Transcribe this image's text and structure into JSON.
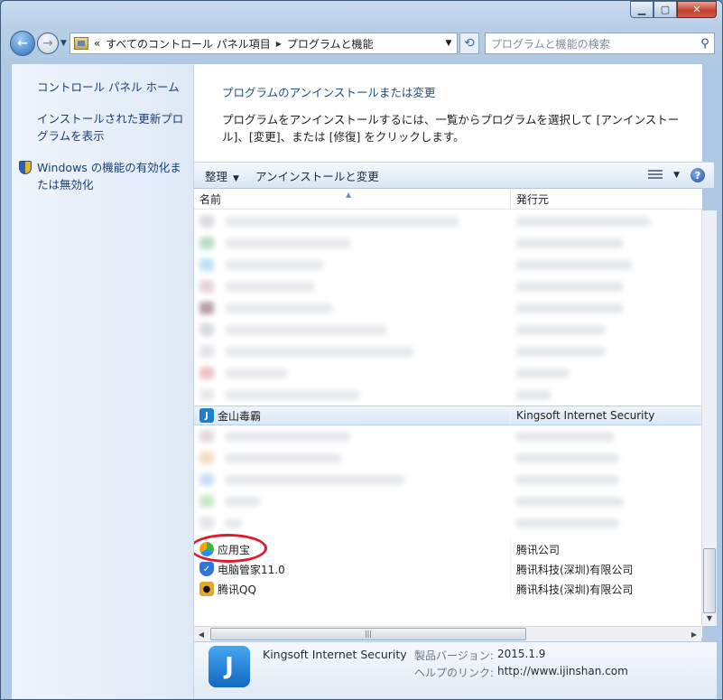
{
  "address": {
    "prefix": "«",
    "crumbs": [
      "すべてのコントロール パネル項目",
      "プログラムと機能"
    ]
  },
  "search": {
    "placeholder": "プログラムと機能の検索"
  },
  "left_pane": {
    "links": [
      "コントロール パネル ホーム",
      "インストールされた更新プログラムを表示",
      "Windows の機能の有効化または無効化"
    ]
  },
  "main": {
    "title": "プログラムのアンインストールまたは変更",
    "description": "プログラムをアンインストールするには、一覧からプログラムを選択して [アンインストール]、[変更]、または [修復] をクリックします。"
  },
  "commandbar": {
    "organize": "整理",
    "uninstall": "アンインストールと変更"
  },
  "columns": {
    "name": "名前",
    "publisher": "発行元"
  },
  "programs": [
    {
      "name": "金山毒霸",
      "publisher": "Kingsoft Internet Security",
      "selected": true,
      "icon": "kingsoft-icon"
    },
    {
      "name": "应用宝",
      "publisher": "腾讯公司",
      "icon": "yingyongbao-icon"
    },
    {
      "name": "电脑管家11.0",
      "publisher": "腾讯科技(深圳)有限公司",
      "icon": "pc-manager-icon"
    },
    {
      "name": "腾讯QQ",
      "publisher": "腾讯科技(深圳)有限公司",
      "icon": "qq-icon"
    }
  ],
  "details": {
    "name": "Kingsoft Internet Security",
    "version_label": "製品バージョン:",
    "version": "2015.1.9",
    "help_label": "ヘルプのリンク:",
    "help_url": "http://www.ijinshan.com"
  },
  "colors": {
    "link": "#1f4c8f",
    "selection": "#dbe8f7",
    "highlight_ring": "#e0192c"
  }
}
